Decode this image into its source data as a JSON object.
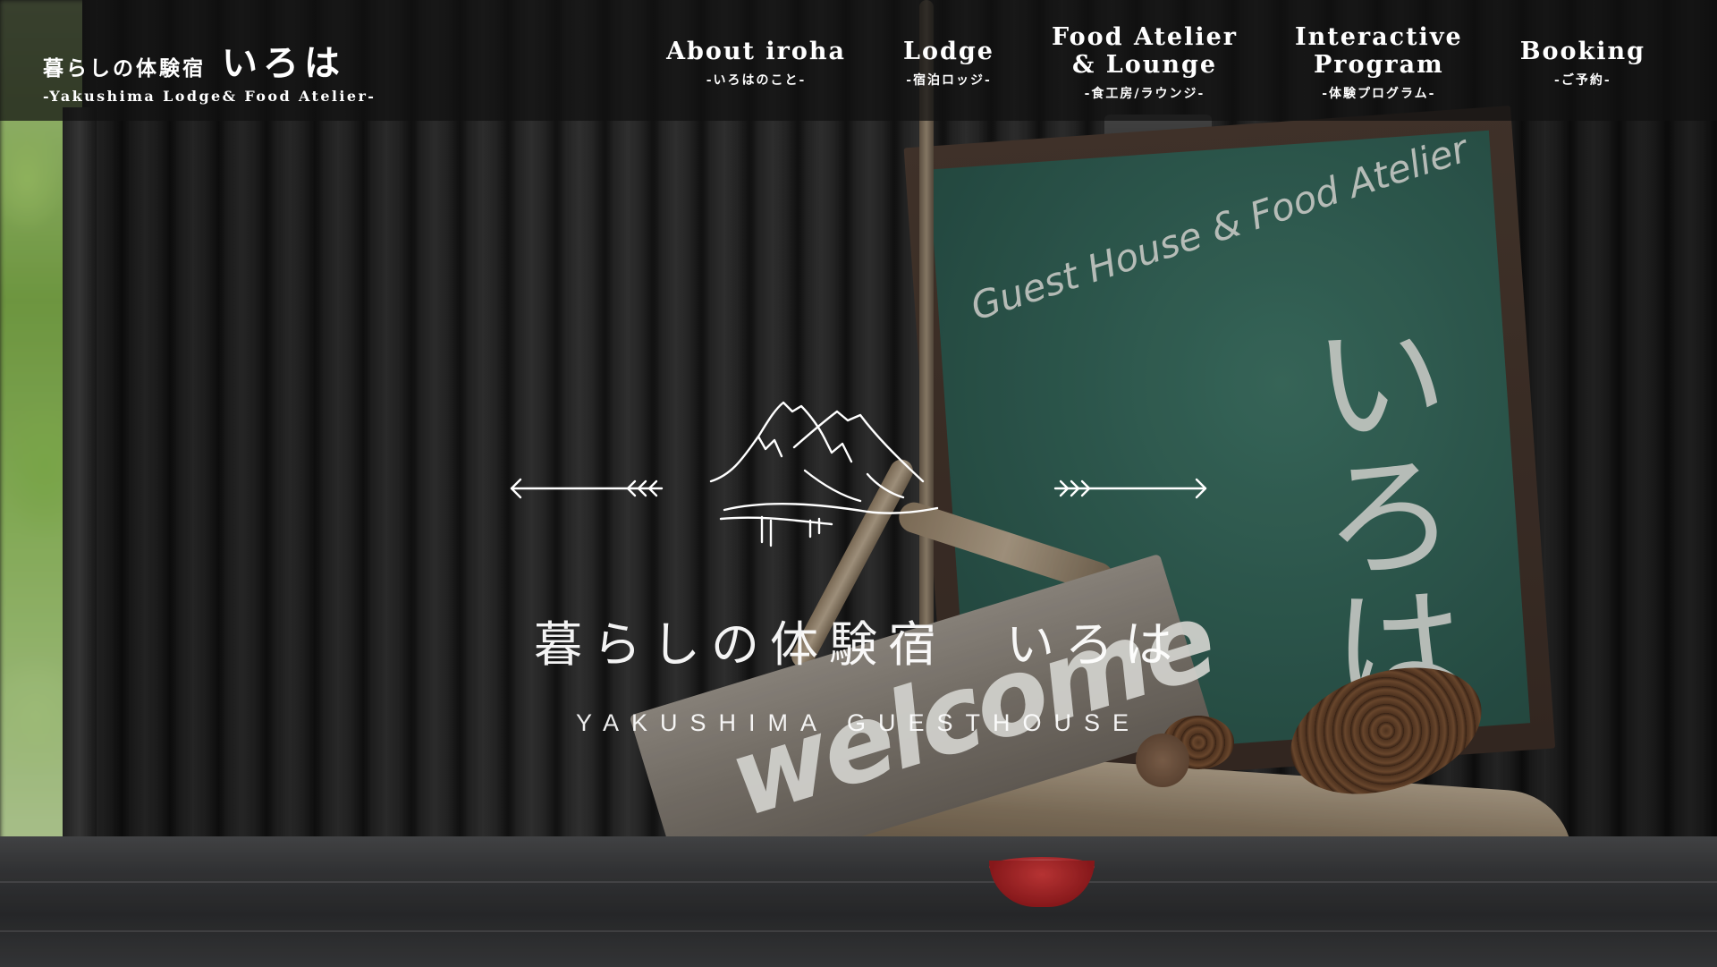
{
  "header": {
    "brand_ja": "暮らしの体験宿",
    "brand_iroha": "いろは",
    "brand_sub": "-Yakushima Lodge& Food Atelier-"
  },
  "nav": [
    {
      "label": "About iroha",
      "sub": "-いろはのこと-"
    },
    {
      "label": "Lodge",
      "sub": "-宿泊ロッジ-"
    },
    {
      "label": "Food Atelier\n& Lounge",
      "sub": "-食工房/ラウンジ-"
    },
    {
      "label": "Interactive\nProgram",
      "sub": "-体験プログラム-"
    },
    {
      "label": "Booking",
      "sub": "-ご予約-"
    }
  ],
  "hero": {
    "title": "暮らしの体験宿　いろは",
    "subtitle": "YAKUSHIMA GUESTHOUSE",
    "chalkboard_line": "Guest House & Food Atelier",
    "chalkboard_name": "いろは",
    "sign_text": "welcome"
  },
  "icons": {
    "logo": "mountain-logo-icon",
    "arrow_left": "arrow-left-icon",
    "arrow_right": "arrow-right-icon"
  },
  "colors": {
    "header_bg": "#111111",
    "text": "#ffffff",
    "chalkboard": "#2f5d52"
  }
}
